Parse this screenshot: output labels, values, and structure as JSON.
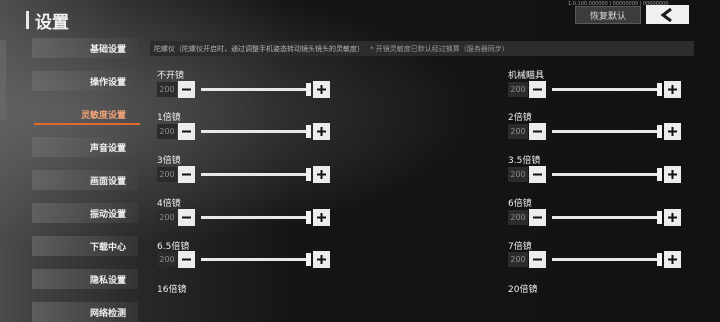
{
  "header": {
    "title": "设置",
    "meta_text": "1.0.100.000000 | 00000000 | 00000000",
    "reset_label": "恢复默认",
    "back_icon": "chevron-left-icon"
  },
  "sidebar": {
    "items": [
      {
        "label": "基础设置"
      },
      {
        "label": "操作设置"
      },
      {
        "label": "灵敏度设置",
        "active": true
      },
      {
        "label": "声音设置"
      },
      {
        "label": "画面设置"
      },
      {
        "label": "振动设置"
      },
      {
        "label": "下载中心"
      },
      {
        "label": "隐私设置"
      },
      {
        "label": "网络检测"
      }
    ],
    "accent_color": "#e06a2a"
  },
  "info": {
    "text": "陀螺仪（陀螺仪开启时，通过调整手机姿态转动镜头镜头的灵敏度）",
    "note": "* 开镜灵敏度已默认经过换算（服务器同步）"
  },
  "groups": [
    {
      "label": "不开镜",
      "value": "200",
      "level": 1.0
    },
    {
      "label": "机械瞄具",
      "value": "200",
      "level": 1.0
    },
    {
      "label": "1倍镜",
      "value": "200",
      "level": 1.0
    },
    {
      "label": "2倍镜",
      "value": "200",
      "level": 1.0
    },
    {
      "label": "3倍镜",
      "value": "200",
      "level": 1.0
    },
    {
      "label": "3.5倍镜",
      "value": "200",
      "level": 1.0
    },
    {
      "label": "4倍镜",
      "value": "200",
      "level": 1.0
    },
    {
      "label": "6倍镜",
      "value": "200",
      "level": 1.0
    },
    {
      "label": "6.5倍镜",
      "value": "200",
      "level": 1.0
    },
    {
      "label": "7倍镜",
      "value": "200",
      "level": 1.0
    },
    {
      "label": "16倍镜"
    },
    {
      "label": "20倍镜"
    }
  ]
}
